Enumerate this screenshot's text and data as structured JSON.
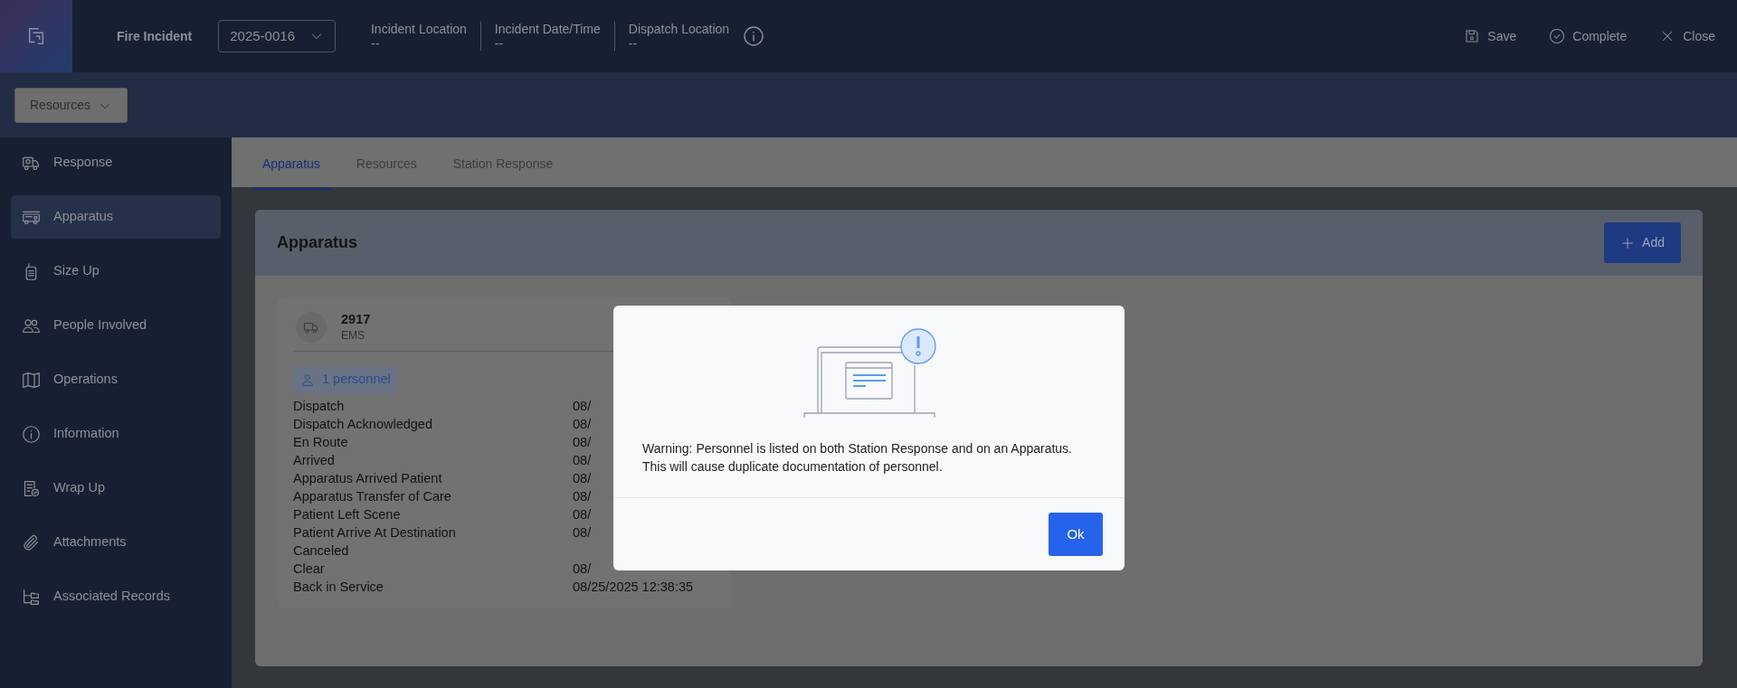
{
  "header": {
    "title": "Fire Incident",
    "incident_number": "2025-0016",
    "fields": [
      {
        "label": "Incident Location",
        "value": "--"
      },
      {
        "label": "Incident Date/Time",
        "value": "--"
      },
      {
        "label": "Dispatch Location",
        "value": "--"
      }
    ],
    "actions": [
      "Save",
      "Complete",
      "Close"
    ]
  },
  "subbar": {
    "dropdown": "Resources"
  },
  "sidebar": {
    "items": [
      {
        "label": "Response",
        "selected": false
      },
      {
        "label": "Apparatus",
        "selected": true
      },
      {
        "label": "Size Up",
        "selected": false
      },
      {
        "label": "People Involved",
        "selected": false
      },
      {
        "label": "Operations",
        "selected": false
      },
      {
        "label": "Information",
        "selected": false
      },
      {
        "label": "Wrap Up",
        "selected": false
      },
      {
        "label": "Attachments",
        "selected": false
      },
      {
        "label": "Associated Records",
        "selected": false
      }
    ]
  },
  "tabs": [
    {
      "label": "Apparatus",
      "selected": true
    },
    {
      "label": "Resources",
      "selected": false
    },
    {
      "label": "Station Response",
      "selected": false
    }
  ],
  "panel": {
    "title": "Apparatus",
    "add_button": "Add",
    "apparatus": {
      "number": "2917",
      "type": "EMS",
      "personnel": "1 personnel",
      "timeline": [
        {
          "label": "Dispatch",
          "value": "08/"
        },
        {
          "label": "Dispatch Acknowledged",
          "value": "08/"
        },
        {
          "label": "En Route",
          "value": "08/"
        },
        {
          "label": "Arrived",
          "value": "08/"
        },
        {
          "label": "Apparatus Arrived Patient",
          "value": "08/"
        },
        {
          "label": "Apparatus Transfer of Care",
          "value": "08/"
        },
        {
          "label": "Patient Left Scene",
          "value": "08/"
        },
        {
          "label": "Patient Arrive At Destination",
          "value": "08/"
        },
        {
          "label": "Canceled"
        },
        {
          "label": "Clear",
          "value": "08/"
        },
        {
          "label": "Back in Service",
          "value": "08/25/2025 12:38:35"
        }
      ]
    }
  },
  "dialog": {
    "message": "Warning: Personnel is listed on both Station Response and on an Apparatus. This will cause duplicate documentation of personnel.",
    "button": "Ok"
  }
}
